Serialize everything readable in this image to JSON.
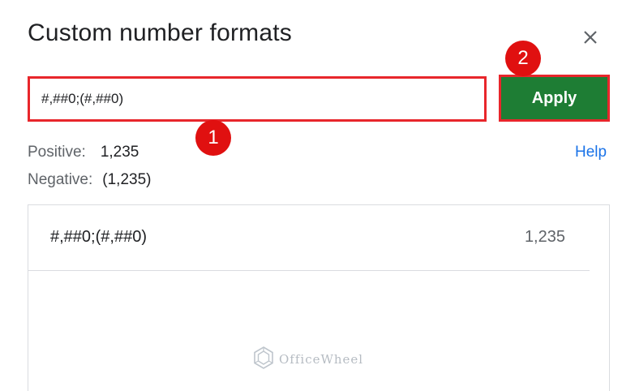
{
  "dialog": {
    "title": "Custom number formats",
    "close_icon": "close-icon"
  },
  "format_input": {
    "value": "#,##0;(#,##0)"
  },
  "apply_button": {
    "label": "Apply"
  },
  "annotations": {
    "badge_1": "1",
    "badge_2": "2"
  },
  "preview": {
    "positive_label": "Positive:",
    "positive_value": "1,235",
    "negative_label": "Negative:",
    "negative_value": "(1,235)"
  },
  "help_link": "Help",
  "format_list": [
    {
      "code": "#,##0;(#,##0)",
      "sample": "1,235"
    }
  ],
  "watermark": {
    "text": "OfficeWheel",
    "icon": "officewheel-logo-icon"
  },
  "colors": {
    "apply_green": "#1e7d34",
    "annotation_red": "#e01010",
    "link_blue": "#1a73e8"
  }
}
